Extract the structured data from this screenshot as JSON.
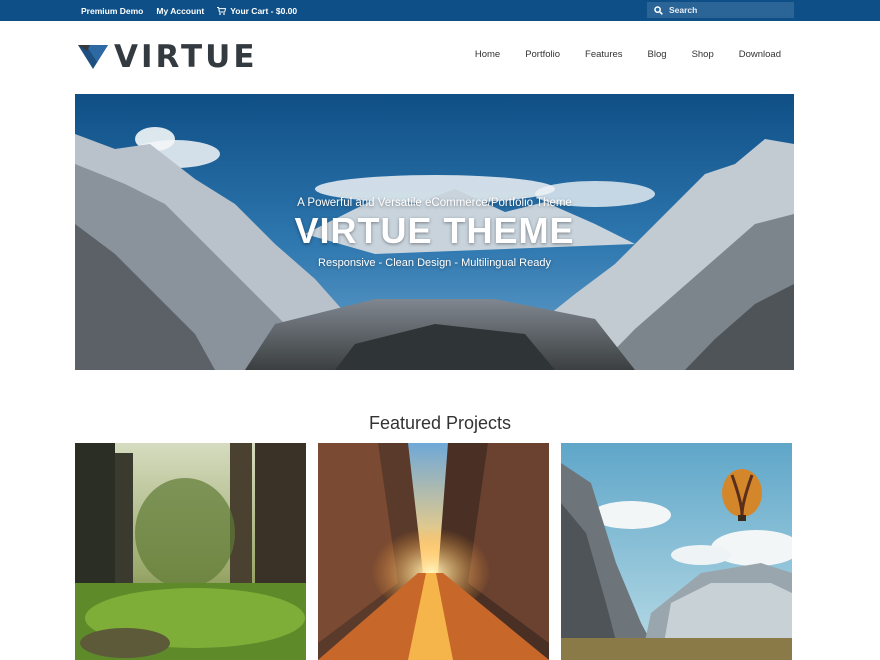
{
  "topbar": {
    "links": [
      "Premium Demo",
      "My Account"
    ],
    "cart_label": "Your Cart - $0.00",
    "search_placeholder": "Search"
  },
  "header": {
    "logo_text": "VIRTUE",
    "nav": [
      "Home",
      "Portfolio",
      "Features",
      "Blog",
      "Shop",
      "Download"
    ]
  },
  "hero": {
    "subtitle": "A Powerful and Versatile eCommerce/Portfolio Theme",
    "title": "VIRTUE THEME",
    "tagline": "Responsive - Clean Design - Multilingual Ready"
  },
  "featured": {
    "title": "Featured Projects"
  },
  "colors": {
    "topbar": "#0d4f86",
    "search_bg": "#2b6496",
    "logo_accent": "#1d4f80",
    "text_dark": "#333a40"
  }
}
